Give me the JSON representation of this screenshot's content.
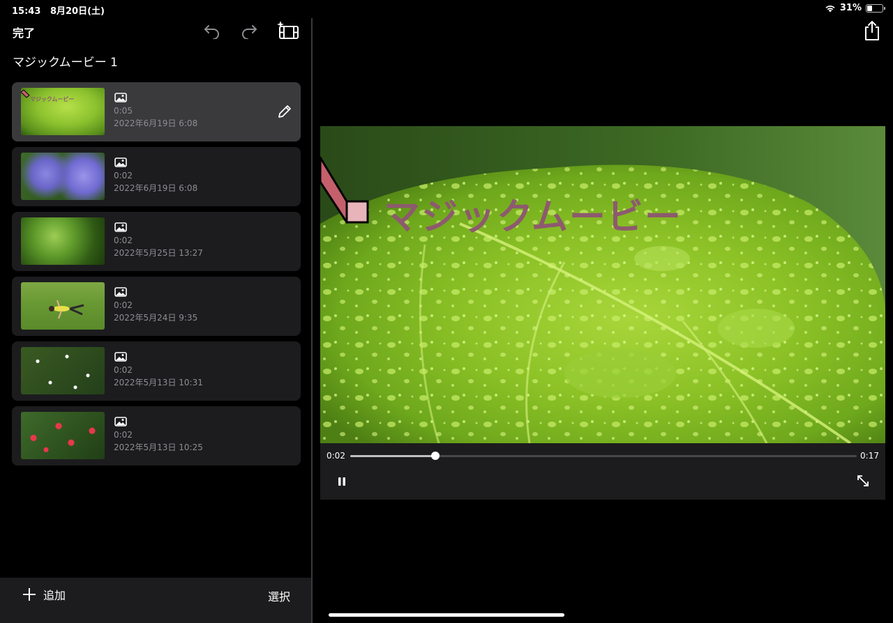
{
  "status_bar": {
    "time": "15:43",
    "date": "8月20日(土)",
    "battery_percent": "31%",
    "battery_level": 0.31
  },
  "toolbar": {
    "done_label": "完了"
  },
  "movie": {
    "title": "マジックムービー 1"
  },
  "clips": [
    {
      "duration": "0:05",
      "date": "2022年6月19日 6:08",
      "selected": true,
      "thumb_overlay": "マジックムービー"
    },
    {
      "duration": "0:02",
      "date": "2022年6月19日 6:08",
      "selected": false
    },
    {
      "duration": "0:02",
      "date": "2022年5月25日 13:27",
      "selected": false
    },
    {
      "duration": "0:02",
      "date": "2022年5月24日 9:35",
      "selected": false
    },
    {
      "duration": "0:02",
      "date": "2022年5月13日 10:31",
      "selected": false
    },
    {
      "duration": "0:02",
      "date": "2022年5月13日 10:25",
      "selected": false
    }
  ],
  "bottom_bar": {
    "add_label": "追加",
    "select_label": "選択"
  },
  "player": {
    "overlay_title": "マジックムービー",
    "current_time": "0:02",
    "total_time": "0:17",
    "progress": 0.168
  },
  "colors": {
    "title_overlay": "#8d5a6e",
    "selected_row": "#3a3a3c",
    "row": "#1c1c1e"
  }
}
